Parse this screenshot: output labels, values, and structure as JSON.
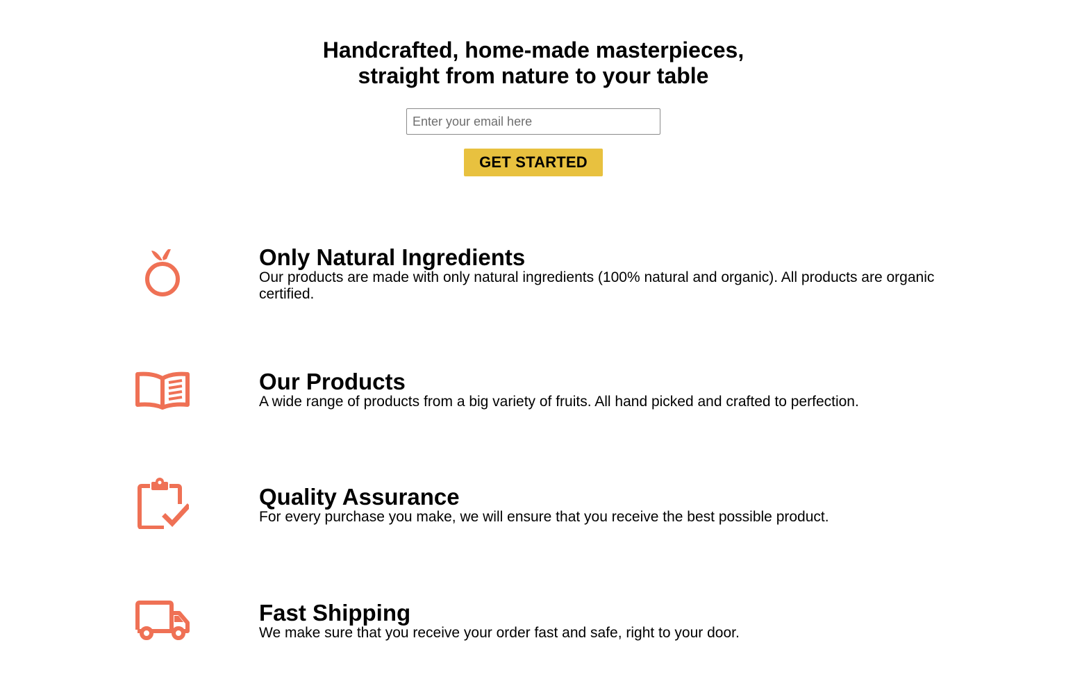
{
  "hero": {
    "title_line1": "Handcrafted, home-made masterpieces,",
    "title_line2": "straight from nature to your table",
    "email_placeholder": "Enter your email here",
    "cta_label": "GET STARTED"
  },
  "colors": {
    "accent": "#ef7155",
    "button": "#e8c13f"
  },
  "features": [
    {
      "icon": "apple-icon",
      "title": "Only Natural Ingredients",
      "description": "Our products are made with only natural ingredients (100% natural and organic). All products are organic certified."
    },
    {
      "icon": "book-open-icon",
      "title": "Our Products",
      "description": "A wide range of products from a big variety of fruits. All hand picked and crafted to perfection."
    },
    {
      "icon": "clipboard-check-icon",
      "title": "Quality Assurance",
      "description": "For every purchase you make, we will ensure that you receive the best possible product."
    },
    {
      "icon": "truck-icon",
      "title": "Fast Shipping",
      "description": "We make sure that you receive your order fast and safe, right to your door."
    }
  ]
}
